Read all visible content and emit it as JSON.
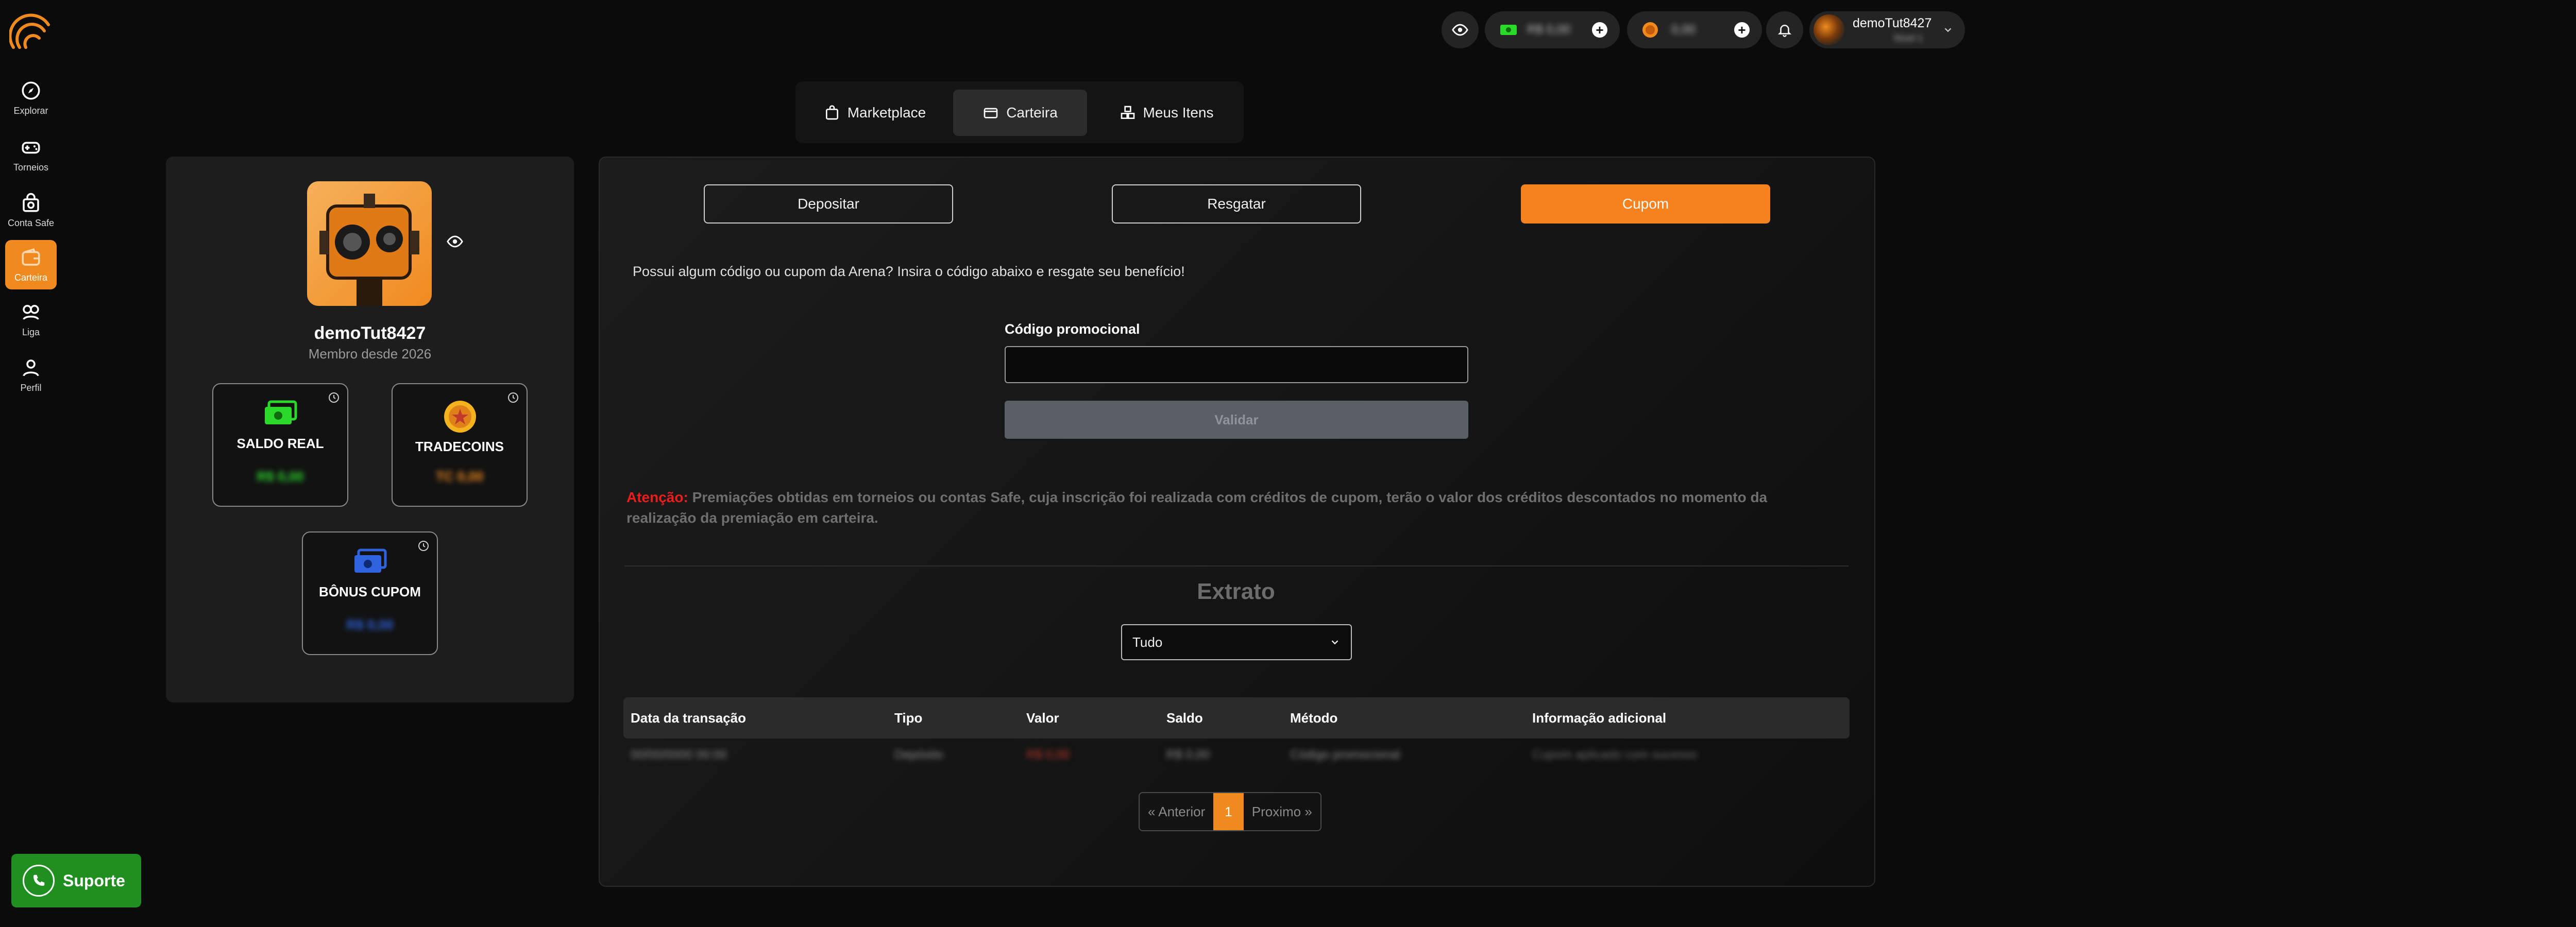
{
  "sidebar": {
    "items": [
      {
        "label": "Explorar",
        "icon": "compass-icon"
      },
      {
        "label": "Torneios",
        "icon": "gamepad-icon"
      },
      {
        "label": "Conta Safe",
        "icon": "safe-account-icon"
      },
      {
        "label": "Carteira",
        "icon": "wallet-icon",
        "active": true
      },
      {
        "label": "Liga",
        "icon": "league-icon"
      },
      {
        "label": "Perfil",
        "icon": "user-icon"
      }
    ]
  },
  "header": {
    "balance_real": "R$ 0,00",
    "balance_coins": "0,00",
    "user": {
      "name": "demoTut8427",
      "sub": "Nível 1"
    }
  },
  "tabs": [
    {
      "label": "Marketplace",
      "icon": "bag-icon"
    },
    {
      "label": "Carteira",
      "icon": "wallet-icon",
      "active": true
    },
    {
      "label": "Meus Itens",
      "icon": "items-icon"
    }
  ],
  "profile": {
    "username": "demoTut8427",
    "member_since": "Membro desde 2026",
    "balances": [
      {
        "title": "SALDO REAL",
        "value": "R$ 0,00",
        "color": "#2bd92b"
      },
      {
        "title": "TRADECOINS",
        "value": "TC 0,00",
        "color": "#f08a1f"
      },
      {
        "title": "BÔNUS CUPOM",
        "value": "R$ 0,00",
        "color": "#2f63e0"
      }
    ]
  },
  "actions": {
    "deposit": "Depositar",
    "withdraw": "Resgatar",
    "coupon": "Cupom"
  },
  "coupon": {
    "info": "Possui algum código ou cupom da Arena? Insira o código abaixo e resgate seu benefício!",
    "field_label": "Código promocional",
    "field_value": "",
    "validate_label": "Validar"
  },
  "warning": {
    "lead": "Atenção:",
    "text": "Premiações obtidas em torneios ou contas Safe, cuja inscrição foi realizada com créditos de cupom, terão o valor dos créditos descontados no momento da realização da premiação em carteira."
  },
  "statement": {
    "title": "Extrato",
    "filter_value": "Tudo",
    "columns": [
      "Data da transação",
      "Tipo",
      "Valor",
      "Saldo",
      "Método",
      "Informação adicional"
    ],
    "rows": [
      [
        "00/00/0000 00:00",
        "Depósito",
        "R$ 0,00",
        "R$ 0,00",
        "Código promocional",
        "Cupom aplicado com sucesso"
      ]
    ]
  },
  "pagination": {
    "prev": "« Anterior",
    "current": "1",
    "next": "Proximo »"
  },
  "support": {
    "label": "Suporte"
  },
  "colors": {
    "accent": "#f08a1f",
    "background": "#0b0b0b",
    "panel": "#1d1d1d",
    "support": "#1f8f1f"
  }
}
